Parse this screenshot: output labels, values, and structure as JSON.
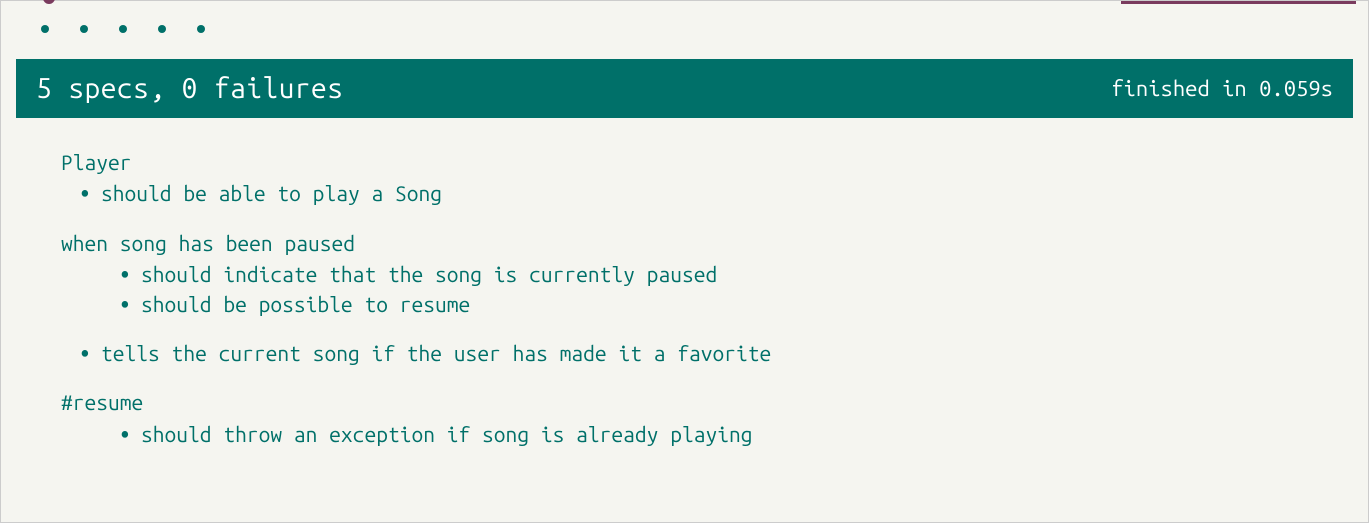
{
  "colors": {
    "primary": "#007069",
    "background": "#f5f5f0",
    "accent": "#7a3b5e"
  },
  "summary": {
    "text": "5 specs, 0 failures",
    "finished": "finished in 0.059s"
  },
  "suites": [
    {
      "name": "Player",
      "specs": [
        "should be able to play a Song"
      ],
      "children": [
        {
          "name": "when song has been paused",
          "specs": [
            "should indicate that the song is currently paused",
            "should be possible to resume"
          ]
        }
      ],
      "specs_after": [
        "tells the current song if the user has made it a favorite"
      ],
      "children_after": [
        {
          "name": "#resume",
          "specs": [
            "should throw an exception if song is already playing"
          ]
        }
      ]
    }
  ]
}
